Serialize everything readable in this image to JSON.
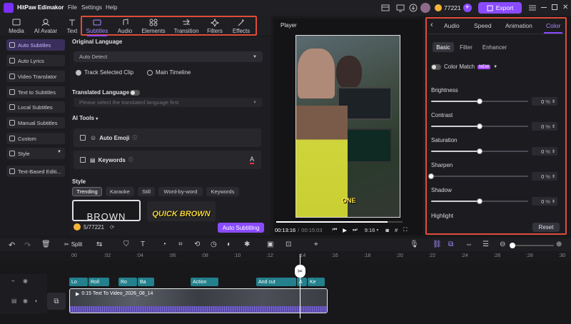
{
  "app": {
    "title": "HitPaw Edimakor",
    "menu": [
      "File",
      "Settings",
      "Help"
    ],
    "credits": "77221",
    "export_label": "Export"
  },
  "toolbar": {
    "tools": [
      {
        "label": "Media"
      },
      {
        "label": "AI Avatar"
      },
      {
        "label": "Text"
      },
      {
        "label": "Subtitles",
        "active": true
      },
      {
        "label": "Audio"
      },
      {
        "label": "Elements"
      },
      {
        "label": "Transition"
      },
      {
        "label": "Filters"
      },
      {
        "label": "Effects"
      }
    ]
  },
  "sidebar": {
    "items": [
      {
        "label": "Auto Subtitles",
        "active": true
      },
      {
        "label": "Auto Lyrics"
      },
      {
        "label": "Video Translator"
      },
      {
        "label": "Text to Subtitles"
      },
      {
        "label": "Local Subtitles"
      },
      {
        "label": "Manual Subtitles"
      },
      {
        "label": "Custom"
      },
      {
        "label": "Style"
      },
      {
        "label": "Text-Based Editi..."
      }
    ]
  },
  "subtitles_panel": {
    "original_language_label": "Original Language",
    "original_language_value": "Auto Detect",
    "radio_track": "Track Selected Clip",
    "radio_main": "Main Timeline",
    "translated_language_label": "Translated Language",
    "translated_placeholder": "Please select the translated language first",
    "ai_tools_label": "AI Tools",
    "auto_emoji": "Auto Emoji",
    "keywords": "Keywords",
    "style_label": "Style",
    "style_tabs": [
      "Trending",
      "Karaoke",
      "Still",
      "Word-by-word",
      "Keywords"
    ],
    "style_preview_1": "BROWN",
    "style_preview_2": "QUICK BROWN",
    "credit_count": "5/77221",
    "auto_subtitling_label": "Auto Subtitling"
  },
  "player": {
    "title": "Player",
    "current_time": "00:13:16",
    "total_time": "00:15:03",
    "aspect": "9:16",
    "progress": 0.88,
    "caption_text": "ONE"
  },
  "right_panel": {
    "tabs": [
      "Audio",
      "Speed",
      "Animation",
      "Color"
    ],
    "active_tab": "Color",
    "subtabs": [
      "Basic",
      "Filter",
      "Enhancer"
    ],
    "color_match_label": "Color Match",
    "new_badge": "NEW",
    "sliders": [
      {
        "label": "Brightness",
        "value": "0",
        "level": 0.5
      },
      {
        "label": "Contrast",
        "value": "0",
        "level": 0.5
      },
      {
        "label": "Saturation",
        "value": "0",
        "level": 0.5
      },
      {
        "label": "Sharpen",
        "value": "0",
        "level": 0.0
      },
      {
        "label": "Shadow",
        "value": "0",
        "level": 0.5
      }
    ],
    "unit": "%",
    "highlight_label": "Highlight",
    "reset_label": "Reset"
  },
  "timeline": {
    "split_label": "Split",
    "ruler": [
      "00",
      ":02",
      ":04",
      ":06",
      ":08",
      ":10",
      ":12",
      ":14",
      ":16",
      ":18",
      ":20",
      ":22",
      ":24",
      ":26",
      ":28",
      ":30"
    ],
    "subtitle_clips": [
      "Lo",
      "Roll",
      "Ro",
      "Ba",
      "Action",
      "And cut",
      "A",
      "Ke"
    ],
    "video_clip_label": "0:15 Text To Video_2026_08_14"
  }
}
